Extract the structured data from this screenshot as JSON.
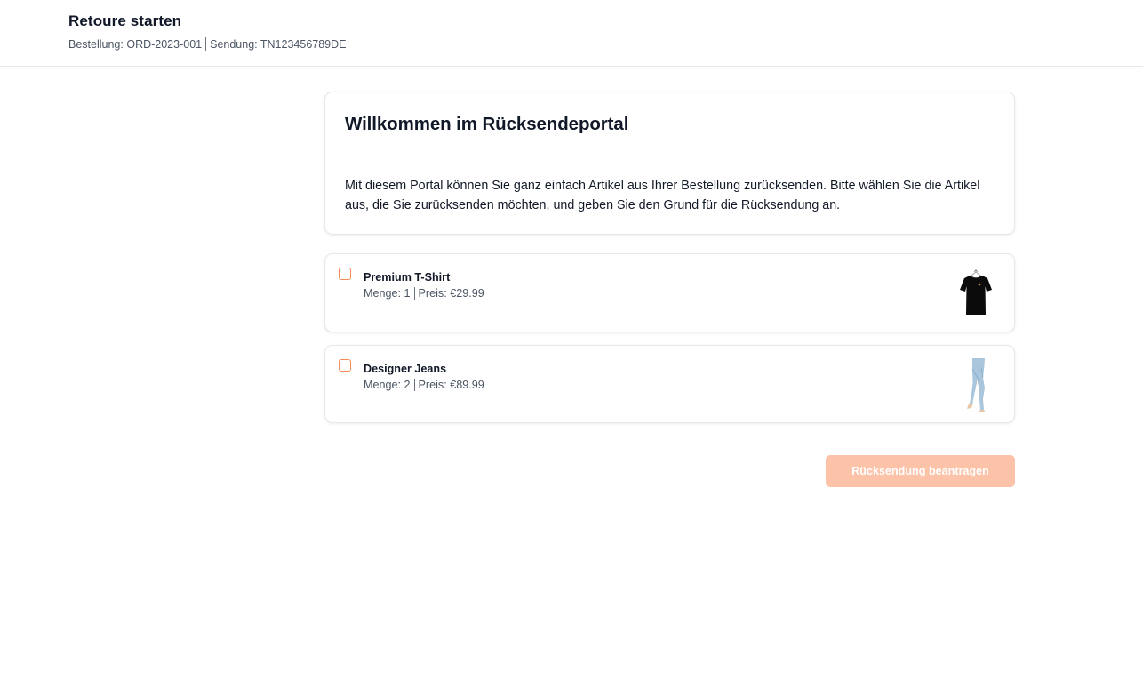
{
  "header": {
    "title": "Retoure starten",
    "order_label": "Bestellung:",
    "order_id": "ORD-2023-001",
    "shipment_label": "Sendung:",
    "shipment_id": "TN123456789DE"
  },
  "welcome": {
    "heading": "Willkommen im Rücksendeportal",
    "text": "Mit diesem Portal können Sie ganz einfach Artikel aus Ihrer Bestellung zurücksenden. Bitte wählen Sie die Artikel aus, die Sie zurücksenden möchten, und geben Sie den Grund für die Rücksendung an."
  },
  "items": [
    {
      "name": "Premium T-Shirt",
      "qty_label": "Menge:",
      "qty": "1",
      "price_label": "Preis:",
      "price": "€29.99",
      "checked": false,
      "image_icon": "tshirt-image"
    },
    {
      "name": "Designer Jeans",
      "qty_label": "Menge:",
      "qty": "2",
      "price_label": "Preis:",
      "price": "€89.99",
      "checked": false,
      "image_icon": "jeans-image"
    }
  ],
  "actions": {
    "submit_label": "Rücksendung beantragen",
    "submit_disabled": true
  },
  "colors": {
    "accent": "#f58a54",
    "button_disabled_bg": "#fcc3a9",
    "text_primary": "#111827",
    "text_secondary": "#4b5563",
    "border": "#e5e7eb"
  }
}
